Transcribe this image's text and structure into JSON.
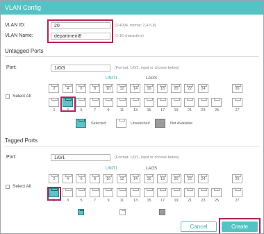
{
  "dialog": {
    "title": "VLAN Config"
  },
  "vlan_id": {
    "label": "VLAN ID:",
    "value": "20",
    "hint": "(2-4094, format: 2,4-5,8)"
  },
  "vlan_name": {
    "label": "VLAN Name:",
    "value": "department8",
    "hint": "(1-16 characters)"
  },
  "untagged": {
    "title": "Untagged Ports",
    "port_label": "Port:",
    "port_value": "1/0/3",
    "port_hint": "(Format: 1/0/1, input or choose below)",
    "unit_head": "UNIT1",
    "lag_head": "LAGS",
    "select_all": "Select All",
    "top_row": [
      "2",
      "4",
      "6",
      "8",
      "10",
      "12",
      "14",
      "16",
      "18",
      "20",
      "22",
      "24",
      "",
      "26"
    ],
    "bottom_row": [
      "1",
      "3",
      "5",
      "7",
      "9",
      "11",
      "13",
      "15",
      "17",
      "19",
      "21",
      "23",
      "25",
      "27"
    ],
    "selected": [
      "3"
    ]
  },
  "legend": {
    "selected": "Selected",
    "unselected": "Unselected",
    "not_available": "Not Available"
  },
  "tagged": {
    "title": "Tagged Ports",
    "port_label": "Port:",
    "port_value": "1/0/1",
    "port_hint": "(Format: 1/0/1, input or choose below)",
    "unit_head": "UNIT1",
    "lag_head": "LAGS",
    "select_all": "Select All",
    "top_row": [
      "2",
      "4",
      "6",
      "8",
      "10",
      "12",
      "14",
      "16",
      "18",
      "20",
      "22",
      "24",
      "",
      "26"
    ],
    "bottom_row": [
      "1",
      "3",
      "5",
      "7",
      "9",
      "11",
      "13",
      "15",
      "17",
      "19",
      "21",
      "23",
      "25",
      "27"
    ],
    "selected": [
      "1"
    ]
  },
  "buttons": {
    "cancel": "Cancel",
    "create": "Create"
  },
  "colors": {
    "accent": "#55c2c4",
    "highlight": "#b0225f",
    "unavailable": "#9a9a9a"
  }
}
